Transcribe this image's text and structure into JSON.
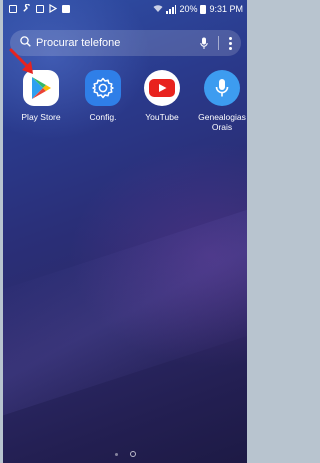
{
  "status_bar": {
    "battery": "20%",
    "time": "9:31 PM"
  },
  "search": {
    "placeholder": "Procurar telefone"
  },
  "apps": [
    {
      "label": "Play Store"
    },
    {
      "label": "Config."
    },
    {
      "label": "YouTube"
    },
    {
      "label": "Genealogias Orais"
    }
  ],
  "colors": {
    "config_blue": "#2f7fe8",
    "youtube_red": "#e8231e",
    "genealogias_blue": "#3d9cf0",
    "arrow_red": "#e5231f"
  }
}
